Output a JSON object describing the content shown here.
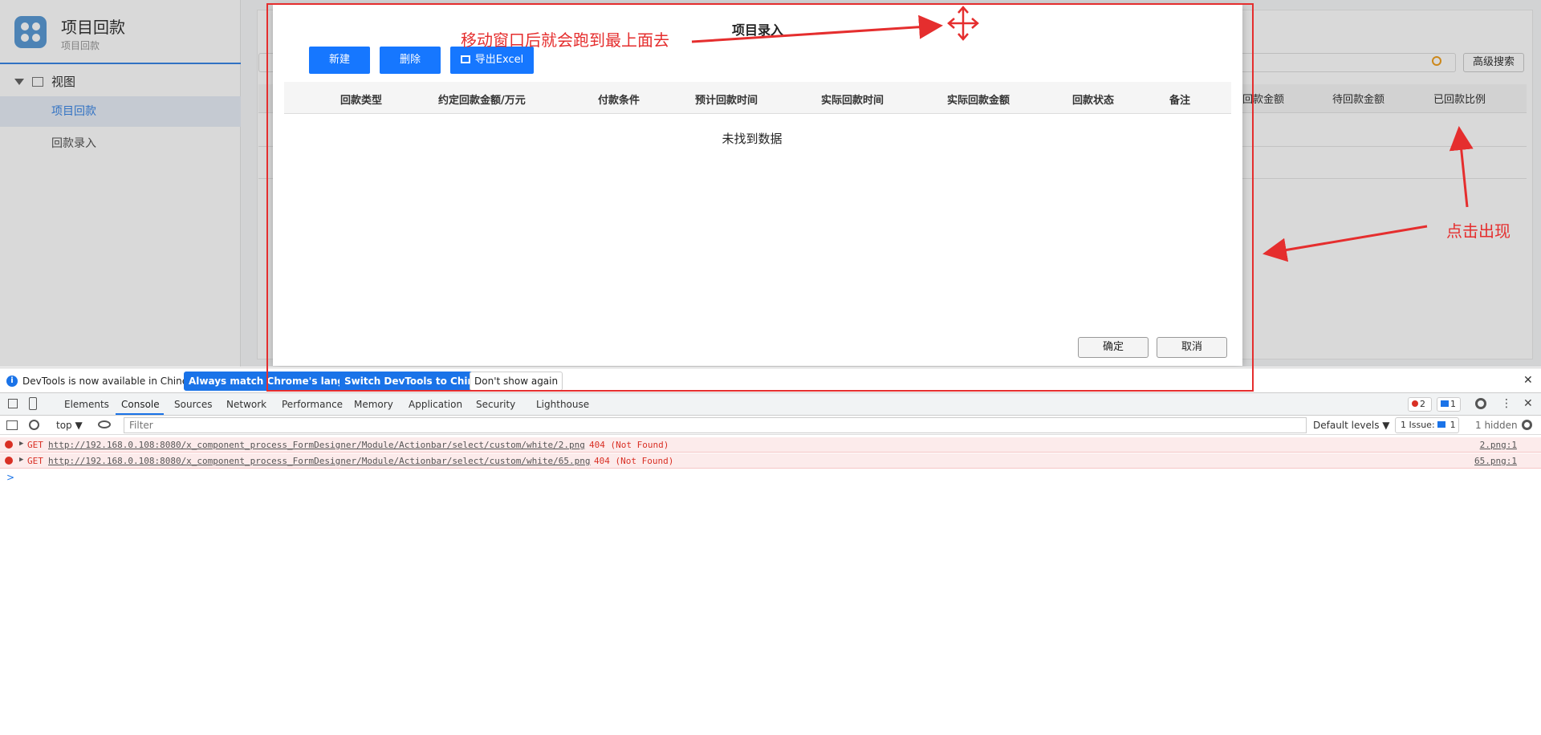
{
  "app": {
    "title": "项目回款",
    "subtitle": "项目回款"
  },
  "sidebar": {
    "view_label": "视图",
    "items": [
      {
        "label": "项目回款",
        "active": true
      },
      {
        "label": "回款录入",
        "active": false
      }
    ]
  },
  "main": {
    "advanced_search_label": "高级搜索",
    "bg_columns": [
      "回款金额",
      "待回款金额",
      "已回款比例"
    ]
  },
  "modal": {
    "title": "项目录入",
    "buttons": {
      "new": "新建",
      "delete": "删除",
      "export": "导出Excel"
    },
    "columns": [
      "回款类型",
      "约定回款金额/万元",
      "付款条件",
      "预计回款时间",
      "实际回款时间",
      "实际回款金额",
      "回款状态",
      "备注"
    ],
    "empty_message": "未找到数据",
    "confirm_label": "确定",
    "cancel_label": "取消"
  },
  "annotations": {
    "top_note": "移动窗口后就会跑到最上面去",
    "right_note": "点击出现",
    "color": "#e52e2e"
  },
  "devtools": {
    "notice": {
      "text": "DevTools is now available in Chinese!",
      "btn_match": "Always match Chrome's language",
      "btn_switch": "Switch DevTools to Chinese",
      "btn_dismiss": "Don't show again"
    },
    "tabs": [
      "Elements",
      "Console",
      "Sources",
      "Network",
      "Performance",
      "Memory",
      "Application",
      "Security",
      "Lighthouse"
    ],
    "active_tab": "Console",
    "error_count": "2",
    "message_count": "1",
    "toolbar": {
      "context": "top ▼",
      "filter_placeholder": "Filter",
      "levels": "Default levels ▼",
      "issues": "1 Issue:",
      "issues_count": "1",
      "hidden": "1 hidden"
    },
    "logs": [
      {
        "method": "GET",
        "url": "http://192.168.0.108:8080/x_component_process_FormDesigner/Module/Actionbar/select/custom/white/2.png",
        "status": "404 (Not Found)",
        "source": "2.png:1"
      },
      {
        "method": "GET",
        "url": "http://192.168.0.108:8080/x_component_process_FormDesigner/Module/Actionbar/select/custom/white/65.png",
        "status": "404 (Not Found)",
        "source": "65.png:1"
      }
    ],
    "prompt": ">"
  }
}
